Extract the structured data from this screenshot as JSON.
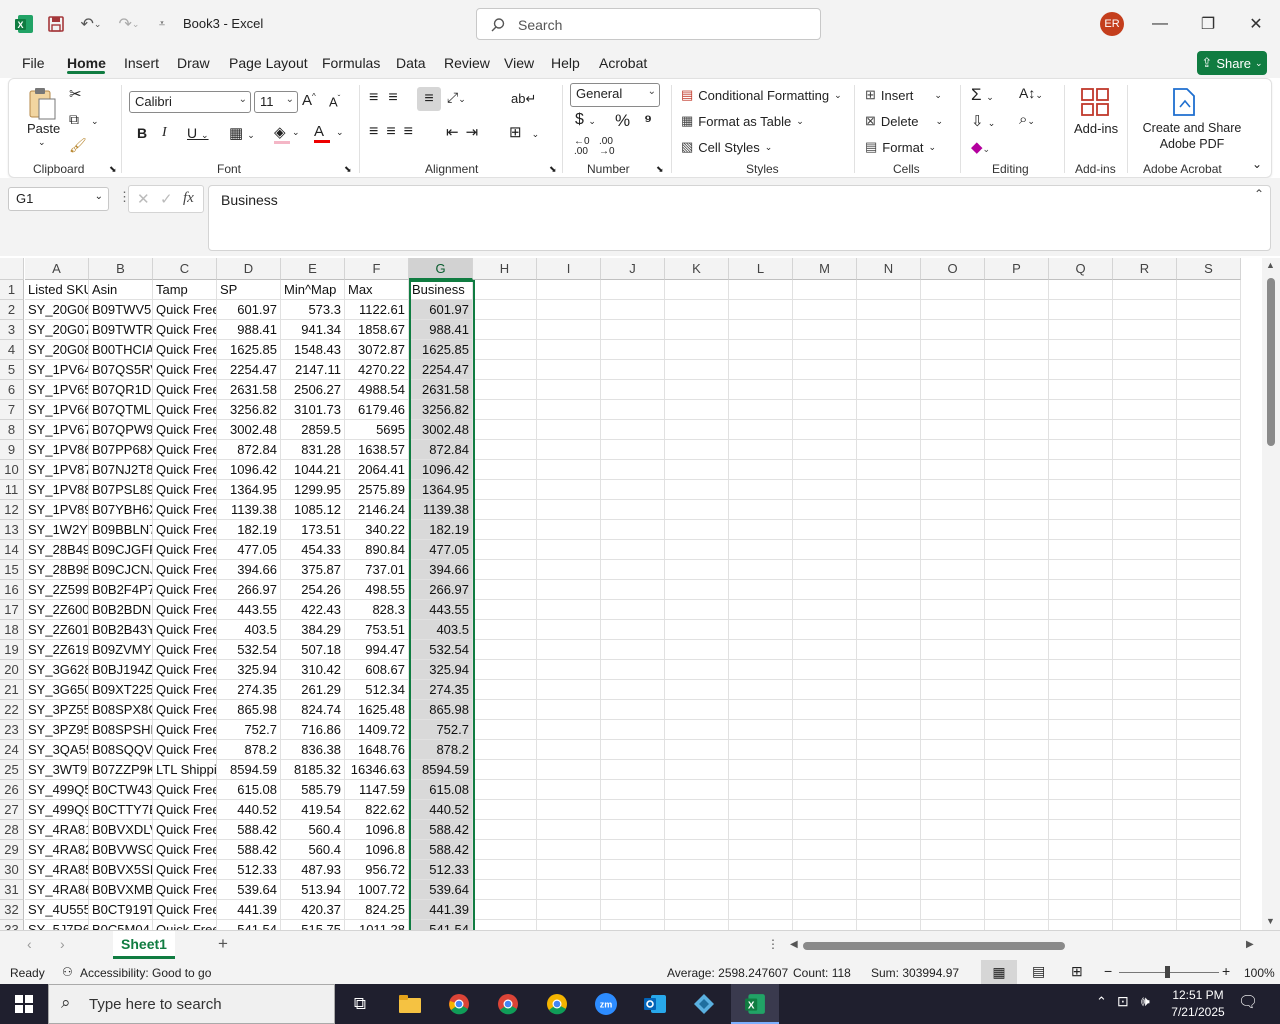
{
  "app": {
    "title": "Book3  -  Excel",
    "user_initials": "ER",
    "accent": "#107c41"
  },
  "search": {
    "placeholder": "Search"
  },
  "menu": {
    "tabs": [
      "File",
      "Home",
      "Insert",
      "Draw",
      "Page Layout",
      "Formulas",
      "Data",
      "Review",
      "View",
      "Help",
      "Acrobat"
    ],
    "share": "Share"
  },
  "ribbon": {
    "clipboard": {
      "paste": "Paste",
      "label": "Clipboard"
    },
    "font": {
      "name": "Calibri",
      "size": "11",
      "label": "Font"
    },
    "alignment": {
      "label": "Alignment"
    },
    "number": {
      "format": "General",
      "label": "Number"
    },
    "styles": {
      "conditional": "Conditional Formatting",
      "format_table": "Format as Table",
      "cell_styles": "Cell Styles",
      "label": "Styles"
    },
    "cells": {
      "insert": "Insert",
      "delete": "Delete",
      "format": "Format",
      "label": "Cells"
    },
    "editing": {
      "label": "Editing"
    },
    "addins": {
      "btn": "Add-ins",
      "label": "Add-ins"
    },
    "acrobat": {
      "btn_line1": "Create and Share",
      "btn_line2": "Adobe PDF",
      "label": "Adobe Acrobat"
    }
  },
  "formula_bar": {
    "name_box": "G1",
    "value": "Business"
  },
  "columns": [
    "A",
    "B",
    "C",
    "D",
    "E",
    "F",
    "G",
    "H",
    "I",
    "J",
    "K",
    "L",
    "M",
    "N",
    "O",
    "P",
    "Q",
    "R",
    "S"
  ],
  "headers": [
    "Listed SKU",
    "Asin",
    "Tamp",
    "SP",
    "Min^Map",
    "Max",
    "Business"
  ],
  "rows": [
    [
      "SY_20G06",
      "B09TWV5I",
      "Quick Free",
      "601.97",
      "573.3",
      "1122.61",
      "601.97"
    ],
    [
      "SY_20G07",
      "B09TWTR7",
      "Quick Free",
      "988.41",
      "941.34",
      "1858.67",
      "988.41"
    ],
    [
      "SY_20G08",
      "B00THCIA",
      "Quick Free",
      "1625.85",
      "1548.43",
      "3072.87",
      "1625.85"
    ],
    [
      "SY_1PV64",
      "B07QS5RV",
      "Quick Free",
      "2254.47",
      "2147.11",
      "4270.22",
      "2254.47"
    ],
    [
      "SY_1PV65",
      "B07QR1DS",
      "Quick Free",
      "2631.58",
      "2506.27",
      "4988.54",
      "2631.58"
    ],
    [
      "SY_1PV66",
      "B07QTMLF",
      "Quick Free",
      "3256.82",
      "3101.73",
      "6179.46",
      "3256.82"
    ],
    [
      "SY_1PV67",
      "B07QPW9",
      "Quick Free",
      "3002.48",
      "2859.5",
      "5695",
      "3002.48"
    ],
    [
      "SY_1PV86",
      "B07PP68X",
      "Quick Free",
      "872.84",
      "831.28",
      "1638.57",
      "872.84"
    ],
    [
      "SY_1PV87",
      "B07NJ2T8",
      "Quick Free",
      "1096.42",
      "1044.21",
      "2064.41",
      "1096.42"
    ],
    [
      "SY_1PV88",
      "B07PSL89",
      "Quick Free",
      "1364.95",
      "1299.95",
      "2575.89",
      "1364.95"
    ],
    [
      "SY_1PV89",
      "B07YBH6X",
      "Quick Free",
      "1139.38",
      "1085.12",
      "2146.24",
      "1139.38"
    ],
    [
      "SY_1W2Y8",
      "B09BBLN7",
      "Quick Free",
      "182.19",
      "173.51",
      "340.22",
      "182.19"
    ],
    [
      "SY_28B49",
      "B09CJGFF",
      "Quick Free",
      "477.05",
      "454.33",
      "890.84",
      "477.05"
    ],
    [
      "SY_28B98",
      "B09CJCNJ",
      "Quick Free",
      "394.66",
      "375.87",
      "737.01",
      "394.66"
    ],
    [
      "SY_2Z599F",
      "B0B2F4P7",
      "Quick Free",
      "266.97",
      "254.26",
      "498.55",
      "266.97"
    ],
    [
      "SY_2Z600F",
      "B0B2BDN",
      "Quick Free",
      "443.55",
      "422.43",
      "828.3",
      "443.55"
    ],
    [
      "SY_2Z601F",
      "B0B2B43Y",
      "Quick Free",
      "403.5",
      "384.29",
      "753.51",
      "403.5"
    ],
    [
      "SY_2Z619F",
      "B09ZVMYF",
      "Quick Free",
      "532.54",
      "507.18",
      "994.47",
      "532.54"
    ],
    [
      "SY_3G628",
      "B0BJ194Z4",
      "Quick Free",
      "325.94",
      "310.42",
      "608.67",
      "325.94"
    ],
    [
      "SY_3G650",
      "B09XT225",
      "Quick Free",
      "274.35",
      "261.29",
      "512.34",
      "274.35"
    ],
    [
      "SY_3PZ55",
      "B08SPX8C",
      "Quick Free",
      "865.98",
      "824.74",
      "1625.48",
      "865.98"
    ],
    [
      "SY_3PZ95",
      "B08SPSHK",
      "Quick Free",
      "752.7",
      "716.86",
      "1409.72",
      "752.7"
    ],
    [
      "SY_3QA55",
      "B08SQQV",
      "Quick Free",
      "878.2",
      "836.38",
      "1648.76",
      "878.2"
    ],
    [
      "SY_3WT91",
      "B07ZZP9K",
      "LTL Shippi",
      "8594.59",
      "8185.32",
      "16346.63",
      "8594.59"
    ],
    [
      "SY_499Q5",
      "B0CTW43",
      "Quick Free",
      "615.08",
      "585.79",
      "1147.59",
      "615.08"
    ],
    [
      "SY_499Q9",
      "B0CTTY7B",
      "Quick Free",
      "440.52",
      "419.54",
      "822.62",
      "440.52"
    ],
    [
      "SY_4RA81",
      "B0BVXDLV",
      "Quick Free",
      "588.42",
      "560.4",
      "1096.8",
      "588.42"
    ],
    [
      "SY_4RA82",
      "B0BVWSG",
      "Quick Free",
      "588.42",
      "560.4",
      "1096.8",
      "588.42"
    ],
    [
      "SY_4RA85",
      "B0BVX5SF",
      "Quick Free",
      "512.33",
      "487.93",
      "956.72",
      "512.33"
    ],
    [
      "SY_4RA86",
      "B0BVXMB",
      "Quick Free",
      "539.64",
      "513.94",
      "1007.72",
      "539.64"
    ],
    [
      "SY_4U555",
      "B0CT919T",
      "Quick Free",
      "441.39",
      "420.37",
      "824.25",
      "441.39"
    ],
    [
      "SY_5J7R6",
      "B0C5M04",
      "Quick Free",
      "541.54",
      "515.75",
      "1011.28",
      "541.54"
    ]
  ],
  "sheet": {
    "name": "Sheet1"
  },
  "status": {
    "ready": "Ready",
    "accessibility": "Accessibility: Good to go",
    "average": "Average: 2598.247607",
    "count": "Count: 118",
    "sum": "Sum: 303994.97",
    "zoom": "100%"
  },
  "taskbar": {
    "search_placeholder": "Type here to search",
    "time": "12:51 PM",
    "date": "7/21/2025"
  }
}
